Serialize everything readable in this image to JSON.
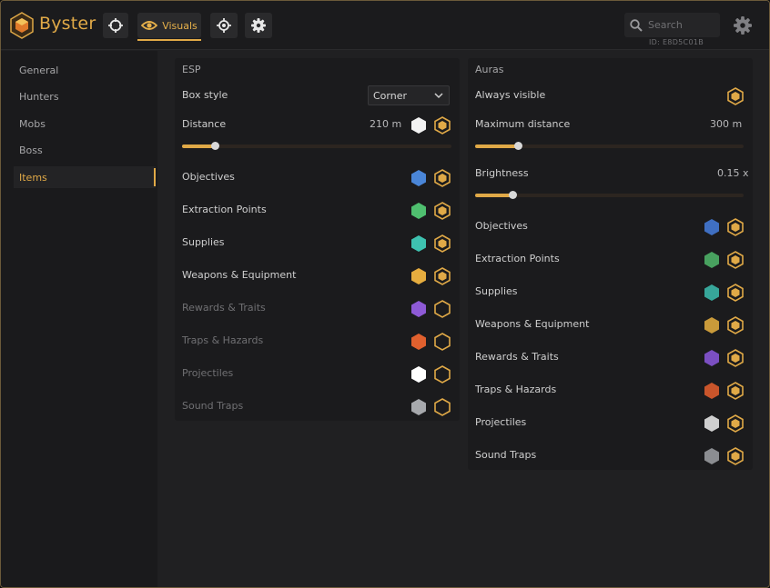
{
  "app": {
    "brand": "Byster"
  },
  "toolbar": {
    "visuals_label": "Visuals",
    "search_placeholder": "Search",
    "search_id": "ID: E8D5C01B",
    "accent": "#e0a947"
  },
  "sidebar": {
    "items": [
      {
        "label": "General",
        "active": false
      },
      {
        "label": "Hunters",
        "active": false
      },
      {
        "label": "Mobs",
        "active": false
      },
      {
        "label": "Boss",
        "active": false
      },
      {
        "label": "Items",
        "active": true
      }
    ]
  },
  "esp": {
    "title": "ESP",
    "box_style_label": "Box style",
    "box_style_value": "Corner",
    "distance_label": "Distance",
    "distance_value": "210 m",
    "distance_fraction": 0.12,
    "items": [
      {
        "label": "Objectives",
        "color": "#4a86d8",
        "enabled": true
      },
      {
        "label": "Extraction Points",
        "color": "#4fbf6f",
        "enabled": true
      },
      {
        "label": "Supplies",
        "color": "#3ec2b0",
        "enabled": true
      },
      {
        "label": "Weapons & Equipment",
        "color": "#e6ad3f",
        "enabled": true
      },
      {
        "label": "Rewards & Traits",
        "color": "#8e5ad6",
        "enabled": false
      },
      {
        "label": "Traps & Hazards",
        "color": "#e0602e",
        "enabled": false
      },
      {
        "label": "Projectiles",
        "color": "#ffffff",
        "enabled": false
      },
      {
        "label": "Sound Traps",
        "color": "#a7a9ad",
        "enabled": false
      }
    ]
  },
  "auras": {
    "title": "Auras",
    "always_visible_label": "Always visible",
    "max_distance_label": "Maximum distance",
    "max_distance_value": "300 m",
    "max_distance_fraction": 0.16,
    "brightness_label": "Brightness",
    "brightness_value": "0.15 x",
    "brightness_fraction": 0.14,
    "items": [
      {
        "label": "Objectives",
        "color": "#3f6fc2",
        "enabled": true
      },
      {
        "label": "Extraction Points",
        "color": "#48a15f",
        "enabled": true
      },
      {
        "label": "Supplies",
        "color": "#37a69a",
        "enabled": true
      },
      {
        "label": "Weapons & Equipment",
        "color": "#c99a3a",
        "enabled": true
      },
      {
        "label": "Rewards & Traits",
        "color": "#7b4fc2",
        "enabled": true
      },
      {
        "label": "Traps & Hazards",
        "color": "#c9552b",
        "enabled": true
      },
      {
        "label": "Projectiles",
        "color": "#cfcfcf",
        "enabled": true
      },
      {
        "label": "Sound Traps",
        "color": "#8b8d91",
        "enabled": true
      }
    ]
  }
}
